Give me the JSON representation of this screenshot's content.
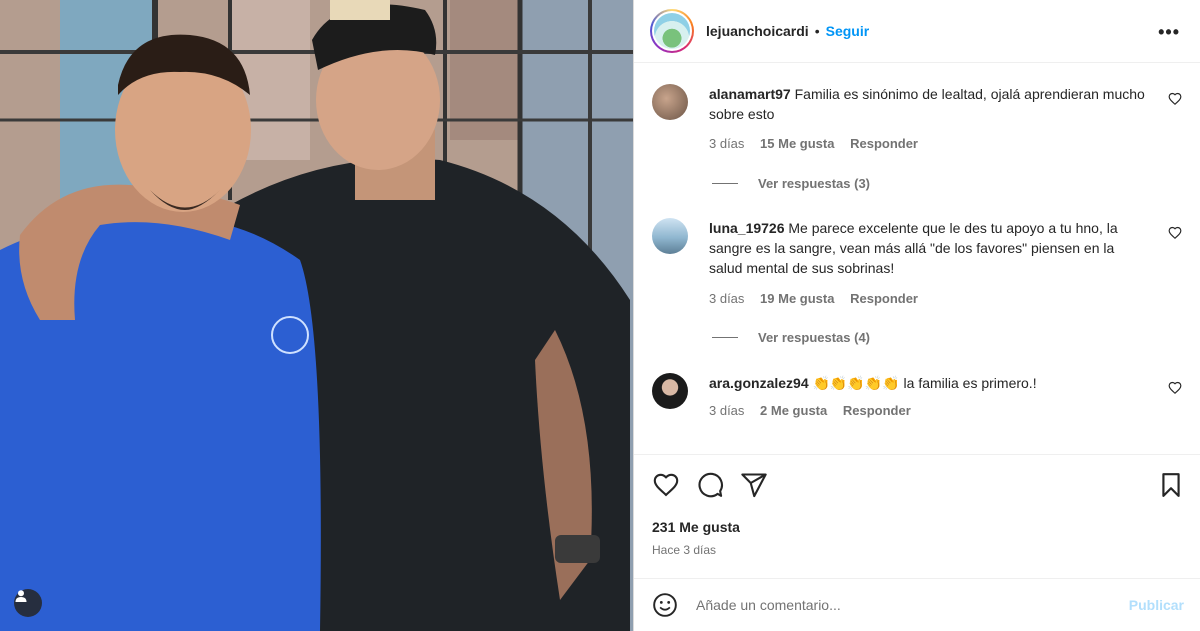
{
  "post": {
    "username": "lejuanchoicardi",
    "separator": "•",
    "follow_label": "Seguir",
    "more_label": "•••",
    "likes": "231 Me gusta",
    "time_ago": "Hace 3 días"
  },
  "comments": [
    {
      "username": "alanamart97",
      "text": "Familia es sinónimo de lealtad, ojalá aprendieran mucho sobre esto",
      "age": "3 días",
      "likes": "15 Me gusta",
      "reply_label": "Responder",
      "view_replies": "Ver respuestas (3)"
    },
    {
      "username": "luna_19726",
      "text": "Me parece excelente que le des tu apoyo a tu hno, la sangre es la sangre, vean más allá \"de los favores\" piensen en la salud mental de sus sobrinas!",
      "age": "3 días",
      "likes": "19 Me gusta",
      "reply_label": "Responder",
      "view_replies": "Ver respuestas (4)"
    },
    {
      "username": "ara.gonzalez94",
      "text": "👏👏👏👏👏 la familia es primero.!",
      "age": "3 días",
      "likes": "2 Me gusta",
      "reply_label": "Responder"
    }
  ],
  "comment_input": {
    "placeholder": "Añade un comentario...",
    "publish_label": "Publicar"
  },
  "icons": [
    "heart-icon",
    "comment-icon",
    "share-icon",
    "bookmark-icon",
    "emoji-icon",
    "more-icon",
    "person-tag-icon"
  ],
  "colors": {
    "accent": "#0095f6",
    "publish_disabled": "#b2dffc",
    "text": "#262626",
    "muted": "#737373"
  }
}
